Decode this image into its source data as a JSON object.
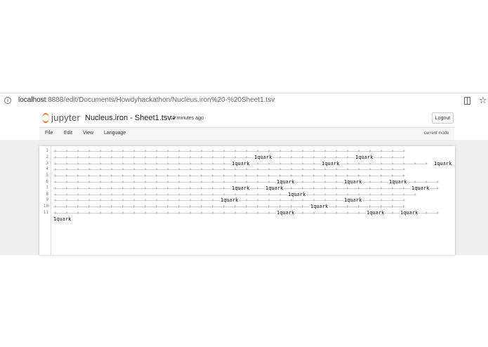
{
  "browser": {
    "url_host": "localhost",
    "url_rest": ":8888/edit/Documents/Howdyhackathon/Nucleus.iron%20-%20Sheet1.tsv"
  },
  "header": {
    "logo_text": "jupyter",
    "filename": "Nucleus.iron - Sheet1.tsv",
    "last_saved": "15 minutes ago",
    "logout_label": "Logout"
  },
  "menu": {
    "items": [
      "File",
      "Edit",
      "View",
      "Language"
    ],
    "mode": "current mode"
  },
  "editor": {
    "line_numbers": [
      "1",
      "2",
      "3",
      "4",
      "5",
      "6",
      "7",
      "8",
      "9",
      "10",
      "11"
    ],
    "cell_text": "1quark",
    "lines": [
      {
        "line": 1,
        "tabs": 32,
        "cells": []
      },
      {
        "line": 2,
        "tabs": 32,
        "cells": [
          18,
          27
        ]
      },
      {
        "line": 3,
        "tabs": 34,
        "cells": [
          16,
          24,
          34
        ]
      },
      {
        "line": 4,
        "tabs": 32,
        "cells": []
      },
      {
        "line": 5,
        "tabs": 32,
        "cells": []
      },
      {
        "line": 6,
        "tabs": 35,
        "cells": [
          20,
          26,
          30
        ]
      },
      {
        "line": 7,
        "tabs": 35,
        "cells": [
          16,
          19,
          32
        ]
      },
      {
        "line": 8,
        "tabs": 33,
        "cells": [
          21
        ]
      },
      {
        "line": 9,
        "tabs": 32,
        "cells": [
          15,
          26
        ]
      },
      {
        "line": 10,
        "tabs": 32,
        "cells": [
          23
        ]
      },
      {
        "line": 11,
        "tabs": 35,
        "cells": [
          20,
          28,
          31
        ]
      }
    ],
    "trailing_cell_line": 12
  }
}
